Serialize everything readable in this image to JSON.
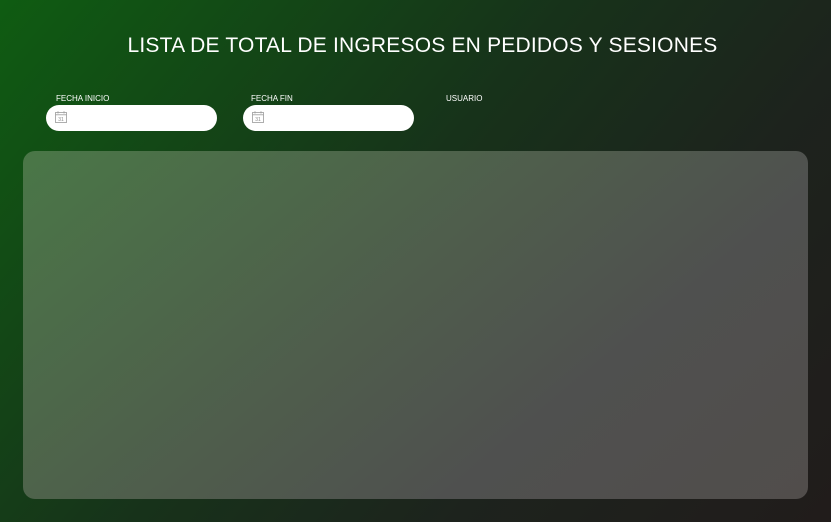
{
  "page": {
    "title": "LISTA DE TOTAL DE INGRESOS EN PEDIDOS Y SESIONES"
  },
  "filters": {
    "start_date": {
      "label": "FECHA INICIO",
      "value": "",
      "icon": "calendar-icon",
      "icon_text": "31"
    },
    "end_date": {
      "label": "FECHA FIN",
      "value": "",
      "icon": "calendar-icon",
      "icon_text": "31"
    },
    "user": {
      "label": "USUARIO"
    }
  },
  "colors": {
    "background_start": "#0f5c12",
    "background_end": "#211c1b",
    "panel": "#4f5d4c",
    "text": "#ffffff"
  }
}
